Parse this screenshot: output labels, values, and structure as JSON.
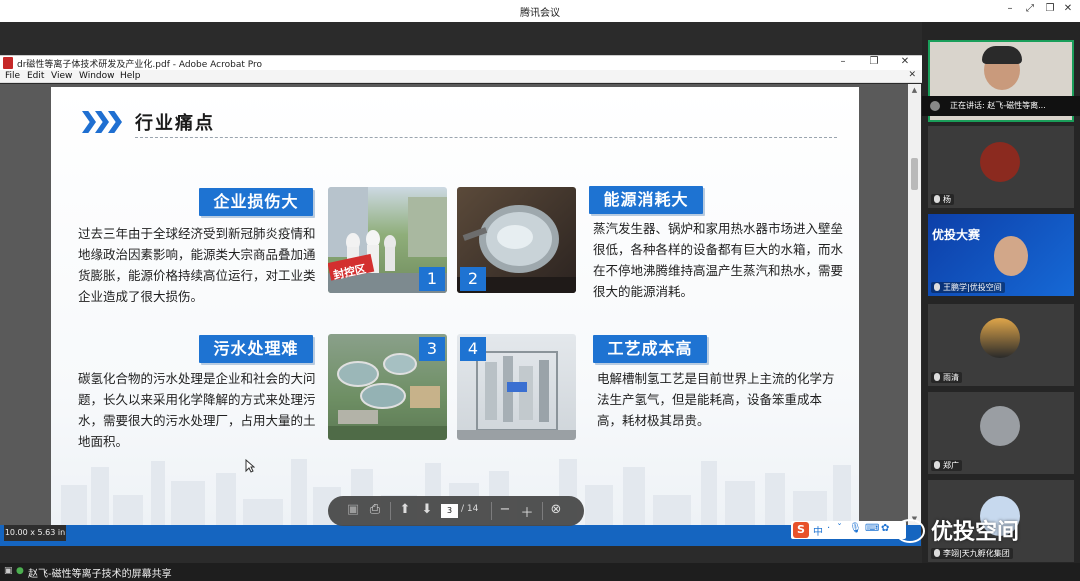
{
  "meeting": {
    "title": "腾讯会议"
  },
  "acrobat": {
    "title": "dr磁性等离子体技术研发及产业化.pdf - Adobe Acrobat Pro",
    "menu": [
      "File",
      "Edit",
      "View",
      "Window",
      "Help"
    ]
  },
  "slide": {
    "title": "行业痛点",
    "sections": [
      {
        "tag": "企业损伤大",
        "text": "过去三年由于全球经济受到新冠肺炎疫情和地缘政治因素影响，能源类大宗商品叠加通货膨胀，能源价格持续高位运行，对工业类企业造成了很大损伤。"
      },
      {
        "tag": "能源消耗大",
        "text": "蒸汽发生器、锅炉和家用热水器市场进入壁垒很低，各种各样的设备都有巨大的水箱，而水在不停地沸腾维持高温产生蒸汽和热水，需要很大的能源消耗。"
      },
      {
        "tag": "污水处理难",
        "text": "碳氢化合物的污水处理是企业和社会的大问题，长久以来采用化学降解的方式来处理污水，需要很大的污水处理厂，占用大量的土地面积。"
      },
      {
        "tag": "工艺成本高",
        "text": "电解槽制氢工艺是目前世界上主流的化学方法生产氢气，但是能耗高，设备笨重成本高，耗材极其昂贵。"
      }
    ],
    "photos": [
      {
        "num": "1",
        "sign": "封控区"
      },
      {
        "num": "2"
      },
      {
        "num": "3"
      },
      {
        "num": "4"
      }
    ]
  },
  "viewer": {
    "size_label": "10.00 x 5.63 in",
    "page_current": "3",
    "page_total": "/ 14"
  },
  "ime": {
    "items": [
      "中",
      "·",
      "ˇ"
    ]
  },
  "status": {
    "sharing": "赵飞-磁性等离子技术的屏幕共享"
  },
  "participants": {
    "speaking": "正在讲话: 赵飞-磁性等离...",
    "tiles": [
      {
        "name": ""
      },
      {
        "name": "杨"
      },
      {
        "name": "王鹏学|优投空间",
        "banner": "优投大赛"
      },
      {
        "name": "雨清"
      },
      {
        "name": "郑广"
      },
      {
        "name": "李翊|天九孵化集团"
      }
    ]
  },
  "watermark": "优投空间",
  "colors": {
    "accent": "#1e73d2",
    "active_border": "#1a9e5a",
    "acrobat_red": "#c62828"
  }
}
